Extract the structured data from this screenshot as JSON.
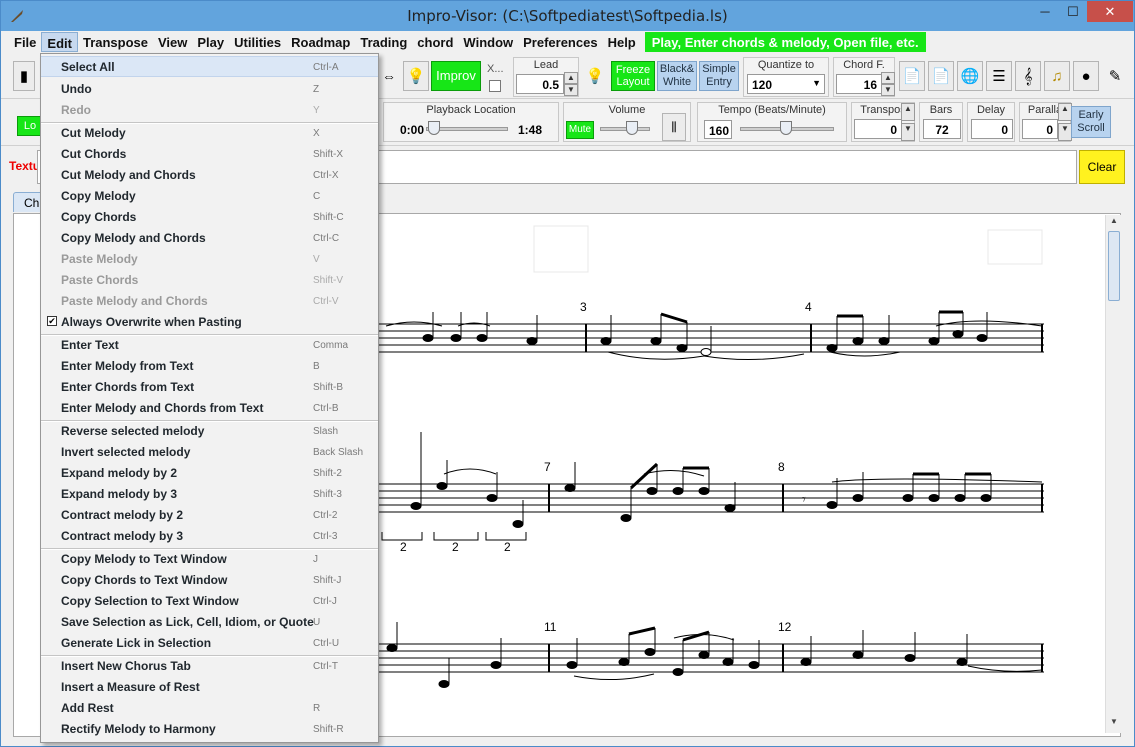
{
  "window": {
    "title": "Impro-Visor: (C:\\Softpediatest\\Softpedia.ls)",
    "minimize": "─",
    "maximize": "☐",
    "close": "✕"
  },
  "menubar": {
    "items": [
      "File",
      "Edit",
      "Transpose",
      "View",
      "Play",
      "Utilities",
      "Roadmap",
      "Trading",
      "chord",
      "Window",
      "Preferences",
      "Help"
    ],
    "status": "Play, Enter chords & melody, Open file, etc."
  },
  "toolbar": {
    "x_label": "X...",
    "lead_label": "Lead",
    "lead_value": "0.5",
    "improv_label": "Improv",
    "freeze_layout": "Freeze Layout",
    "black_white": "Black& White",
    "simple_entry": "Simple Entry",
    "quantize_label": "Quantize to",
    "quantize_value": "120",
    "chord_font_label": "Chord F.",
    "chord_font_value": "16"
  },
  "toolbar2": {
    "loop_label": "Lo",
    "playback_label": "Playback Location",
    "time_start": "0:00",
    "time_end": "1:48",
    "volume_label": "Volume",
    "mute_label": "Mute",
    "tempo_label": "Tempo (Beats/Minute)",
    "tempo_value": "160",
    "transpose_label": "Transpos",
    "transpose_value": "0",
    "bars_label": "Bars",
    "bars_value": "72",
    "delay_label": "Delay",
    "delay_value": "0",
    "parallax_label": "Paralla",
    "parallax_value": "0",
    "early_scroll": "Early Scroll"
  },
  "textrow": {
    "label": "Textu",
    "clear": "Clear"
  },
  "tabs": [
    {
      "label": "Ch"
    }
  ],
  "measures": [
    "3",
    "4",
    "7",
    "8",
    "11",
    "12"
  ],
  "triplets": [
    "2",
    "2",
    "2"
  ],
  "edit_menu": {
    "items": [
      {
        "label": "Select All",
        "shortcut": "Ctrl-A",
        "enabled": true,
        "highlight": true
      },
      {
        "label": "Undo",
        "shortcut": "Z",
        "enabled": true
      },
      {
        "label": "Redo",
        "shortcut": "Y",
        "enabled": false
      },
      {
        "label": "Cut Melody",
        "shortcut": "X",
        "enabled": true
      },
      {
        "label": "Cut Chords",
        "shortcut": "Shift-X",
        "enabled": true
      },
      {
        "label": "Cut Melody and Chords",
        "shortcut": "Ctrl-X",
        "enabled": true
      },
      {
        "label": "Copy Melody",
        "shortcut": "C",
        "enabled": true
      },
      {
        "label": "Copy Chords",
        "shortcut": "Shift-C",
        "enabled": true
      },
      {
        "label": "Copy Melody and Chords",
        "shortcut": "Ctrl-C",
        "enabled": true
      },
      {
        "label": "Paste Melody",
        "shortcut": "V",
        "enabled": false
      },
      {
        "label": "Paste Chords",
        "shortcut": "Shift-V",
        "enabled": false
      },
      {
        "label": "Paste Melody and Chords",
        "shortcut": "Ctrl-V",
        "enabled": false
      },
      {
        "label": "Always Overwrite when Pasting",
        "shortcut": "",
        "enabled": true,
        "checked": true
      },
      {
        "label": "Enter Text",
        "shortcut": "Comma",
        "enabled": true
      },
      {
        "label": "Enter Melody from Text",
        "shortcut": "B",
        "enabled": true
      },
      {
        "label": "Enter Chords from Text",
        "shortcut": "Shift-B",
        "enabled": true
      },
      {
        "label": "Enter Melody and Chords from Text",
        "shortcut": "Ctrl-B",
        "enabled": true
      },
      {
        "label": "Reverse selected melody",
        "shortcut": "Slash",
        "enabled": true
      },
      {
        "label": "Invert selected melody",
        "shortcut": "Back Slash",
        "enabled": true
      },
      {
        "label": "Expand melody by 2",
        "shortcut": "Shift-2",
        "enabled": true
      },
      {
        "label": "Expand melody by 3",
        "shortcut": "Shift-3",
        "enabled": true
      },
      {
        "label": "Contract melody by 2",
        "shortcut": "Ctrl-2",
        "enabled": true
      },
      {
        "label": "Contract melody by 3",
        "shortcut": "Ctrl-3",
        "enabled": true
      },
      {
        "label": "Copy Melody to Text Window",
        "shortcut": "J",
        "enabled": true
      },
      {
        "label": "Copy Chords to Text Window",
        "shortcut": "Shift-J",
        "enabled": true
      },
      {
        "label": "Copy Selection to Text Window",
        "shortcut": "Ctrl-J",
        "enabled": true
      },
      {
        "label": "Save Selection as Lick, Cell, Idiom, or Quote",
        "shortcut": "U",
        "enabled": true
      },
      {
        "label": "Generate Lick in Selection",
        "shortcut": "Ctrl-U",
        "enabled": true
      },
      {
        "label": "Insert New Chorus Tab",
        "shortcut": "Ctrl-T",
        "enabled": true
      },
      {
        "label": "Insert a Measure of Rest",
        "shortcut": "",
        "enabled": true
      },
      {
        "label": "Add Rest",
        "shortcut": "R",
        "enabled": true
      },
      {
        "label": "Rectify Melody to Harmony",
        "shortcut": "Shift-R",
        "enabled": true
      }
    ]
  }
}
